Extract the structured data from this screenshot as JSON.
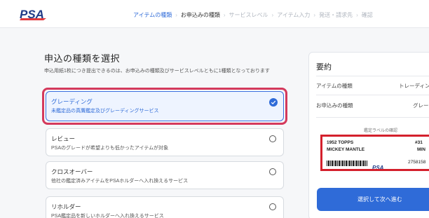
{
  "header": {
    "logo_text": "PSA",
    "steps": [
      {
        "label": "アイテムの種類",
        "state": "done"
      },
      {
        "label": "お申込みの種類",
        "state": "current"
      },
      {
        "label": "サービスレベル",
        "state": "upcoming"
      },
      {
        "label": "アイテム入力",
        "state": "upcoming"
      },
      {
        "label": "発送・請求先",
        "state": "upcoming"
      },
      {
        "label": "確認",
        "state": "upcoming"
      }
    ],
    "separator": "›"
  },
  "main": {
    "title": "申込の種類を選択",
    "subtitle": "申込用紙1枚につき提出できるのは、お申込みの種類及びサービスレベルともに1種類となっております",
    "options": [
      {
        "title": "グレーディング",
        "desc": "未鑑定品の真贋鑑定及びグレーディングサービス",
        "selected": true
      },
      {
        "title": "レビュー",
        "desc": "PSAのグレードが希望よりも低かったアイテムが対象",
        "selected": false
      },
      {
        "title": "クロスオーバー",
        "desc": "他社の鑑定済みアイテムをPSAホルダーへ入れ換えるサービス",
        "selected": false
      },
      {
        "title": "リホルダー",
        "desc": "PSA鑑定品を新しいホルダーへ入れ換えるサービス",
        "selected": false
      }
    ]
  },
  "summary": {
    "title": "要約",
    "rows": [
      {
        "label": "アイテムの種類",
        "value": "トレーディン"
      },
      {
        "label": "お申込みの種類",
        "value": "グレー"
      }
    ],
    "label_caption": "鑑定ラベルの確認",
    "cert": {
      "line1_left": "1952 TOPPS",
      "line1_right": "#31",
      "line2_left": "MICKEY MANTLE",
      "line2_right": "MIN",
      "number": "2758158",
      "logo_text": "PSA"
    },
    "next_button": "選択して次へ進む"
  },
  "colors": {
    "accent": "#2f6bd8",
    "highlight": "#d4395c",
    "label_border": "#d4202c",
    "logo_red": "#e03a3e",
    "logo_blue": "#1f3b87"
  }
}
